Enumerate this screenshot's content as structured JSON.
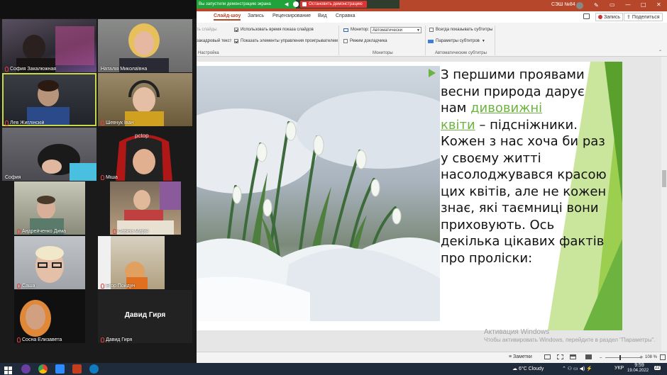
{
  "share_bar": {
    "sharing_text": "Вы запустили демонстрацию экрана",
    "stop_label": "Остановить демонстрацию"
  },
  "gallery": {
    "participants": [
      {
        "name": "София Закалюжная",
        "muted": true
      },
      {
        "name": "Наталія Миколаївна",
        "muted": false
      },
      {
        "name": "Лев Жиглінскій",
        "muted": true
      },
      {
        "name": "Шевчук Іван",
        "muted": true
      },
      {
        "name": "София",
        "muted": false
      },
      {
        "name": "Міша",
        "muted": true
      },
      {
        "name": "Андрейченко Дима",
        "muted": true
      },
      {
        "name": "Савіна Марія",
        "muted": true
      },
      {
        "name": "Саша",
        "muted": true
      },
      {
        "name": "Егор Пойдун",
        "muted": true
      },
      {
        "name": "Сосна Елизавета",
        "muted": true
      },
      {
        "name": "Давид Гиря",
        "muted": true
      }
    ],
    "no_video_name": "Давид Гиря"
  },
  "titlebar": {
    "account": "СЭШ №84",
    "minimize": "—",
    "maximize": "□",
    "close": "✕"
  },
  "tabs": [
    {
      "label": "Слайд-шоу",
      "selected": true
    },
    {
      "label": "Запись",
      "selected": false
    },
    {
      "label": "Рецензирование",
      "selected": false
    },
    {
      "label": "Вид",
      "selected": false
    },
    {
      "label": "Справка",
      "selected": false
    }
  ],
  "header_buttons": {
    "record": "Запись",
    "share": "Поделиться"
  },
  "ribbon": {
    "setup": {
      "hide_slides": "ть слайды",
      "use_timings": "Использовать время показа слайдов",
      "narration": "закадровый текст",
      "show_media_controls": "Показать элементы управления проигрывателем",
      "group_label": "Настройка"
    },
    "monitors": {
      "monitor_label": "Монитор:",
      "monitor_value": "Автоматически",
      "presenter_view": "Режим докладчика",
      "group_label": "Мониторы"
    },
    "captions": {
      "always_show": "Всегда показывать субтитры",
      "settings": "Параметры субтитров",
      "group_label": "Автоматические субтитры"
    }
  },
  "slide": {
    "line1": "З першими проявами",
    "line2": "весни  природа дарує",
    "line3_prefix": "нам ",
    "highlight_a": "дивовижні",
    "highlight_b": "квіти",
    "line4_suffix": " – підсніжники.",
    "rest": "Кожен з нас хоча би раз у своєму житті насолоджувався красою цих квітів, але не кожен знає, які таємниці вони приховують. Ось декілька цікавих фактів про проліски:"
  },
  "watermark": {
    "title": "Активация Windows",
    "subtitle": "Чтобы активировать Windows, перейдите в раздел \"Параметры\"."
  },
  "statusbar": {
    "notes": "Заметки",
    "zoom": "108 %"
  },
  "taskbar": {
    "weather": "6°C  Cloudy",
    "lang": "УКР",
    "time": "9:59",
    "date": "19.04.2022",
    "notif_count": "22"
  },
  "colors": {
    "ppt_accent": "#b7472a",
    "slide_green": "#6cb33f",
    "share_green": "#1fa33a",
    "stop_red": "#dd3333"
  }
}
